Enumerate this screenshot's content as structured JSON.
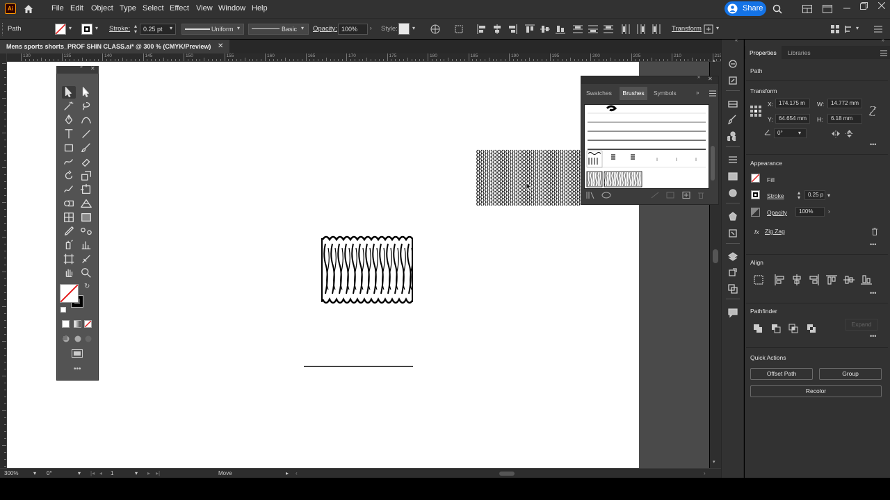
{
  "app": {
    "logo": "Ai",
    "home_icon": "home-icon"
  },
  "menu": [
    "File",
    "Edit",
    "Object",
    "Type",
    "Select",
    "Effect",
    "View",
    "Window",
    "Help"
  ],
  "share_label": "Share",
  "control": {
    "selection_type": "Path",
    "stroke_label": "Stroke:",
    "stroke_value": "0.25 pt",
    "profile_label": "Uniform",
    "brush_label": "Basic",
    "opacity_label": "Opacity:",
    "opacity_value": "100%",
    "style_label": "Style:",
    "transform_label": "Transform"
  },
  "document_tab": {
    "title": "Mens sports shorts_PROF SHIN CLASS.ai* @ 300 % (CMYK/Preview)",
    "close": "✕"
  },
  "ruler_labels": [
    "130",
    "135",
    "140",
    "145",
    "150",
    "155",
    "160",
    "165",
    "170",
    "175",
    "180",
    "185",
    "190",
    "195",
    "200",
    "205",
    "210",
    "215"
  ],
  "status": {
    "zoom": "300%",
    "rotation": "0°",
    "artboard_num": "1",
    "tool": "Move"
  },
  "brushes_panel": {
    "tabs": [
      "Swatches",
      "Brushes",
      "Symbols"
    ],
    "active_tab": "Brushes"
  },
  "properties": {
    "tabs": [
      "Properties",
      "Libraries"
    ],
    "selection": "Path",
    "transform": {
      "title": "Transform",
      "x_label": "X:",
      "x": "174.175 m",
      "y_label": "Y:",
      "y": "64.654 mm",
      "w_label": "W:",
      "w": "14.772 mm",
      "h_label": "H:",
      "h": "6.18 mm",
      "angle": "0°"
    },
    "appearance": {
      "title": "Appearance",
      "fill": "Fill",
      "stroke": "Stroke",
      "stroke_value": "0.25 p",
      "opacity": "Opacity",
      "opacity_value": "100%",
      "effect": "Zig Zag",
      "fx": "fx"
    },
    "align_title": "Align",
    "pathfinder": {
      "title": "Pathfinder",
      "expand": "Expand"
    },
    "quick_actions": {
      "title": "Quick Actions",
      "offset_path": "Offset Path",
      "group": "Group",
      "recolor": "Recolor"
    }
  },
  "colors": {
    "accent": "#1473e6",
    "logo_bg": "#310000",
    "logo_fg": "#ff9a00",
    "ui_dark": "#323232",
    "canvas": "#ffffff"
  }
}
